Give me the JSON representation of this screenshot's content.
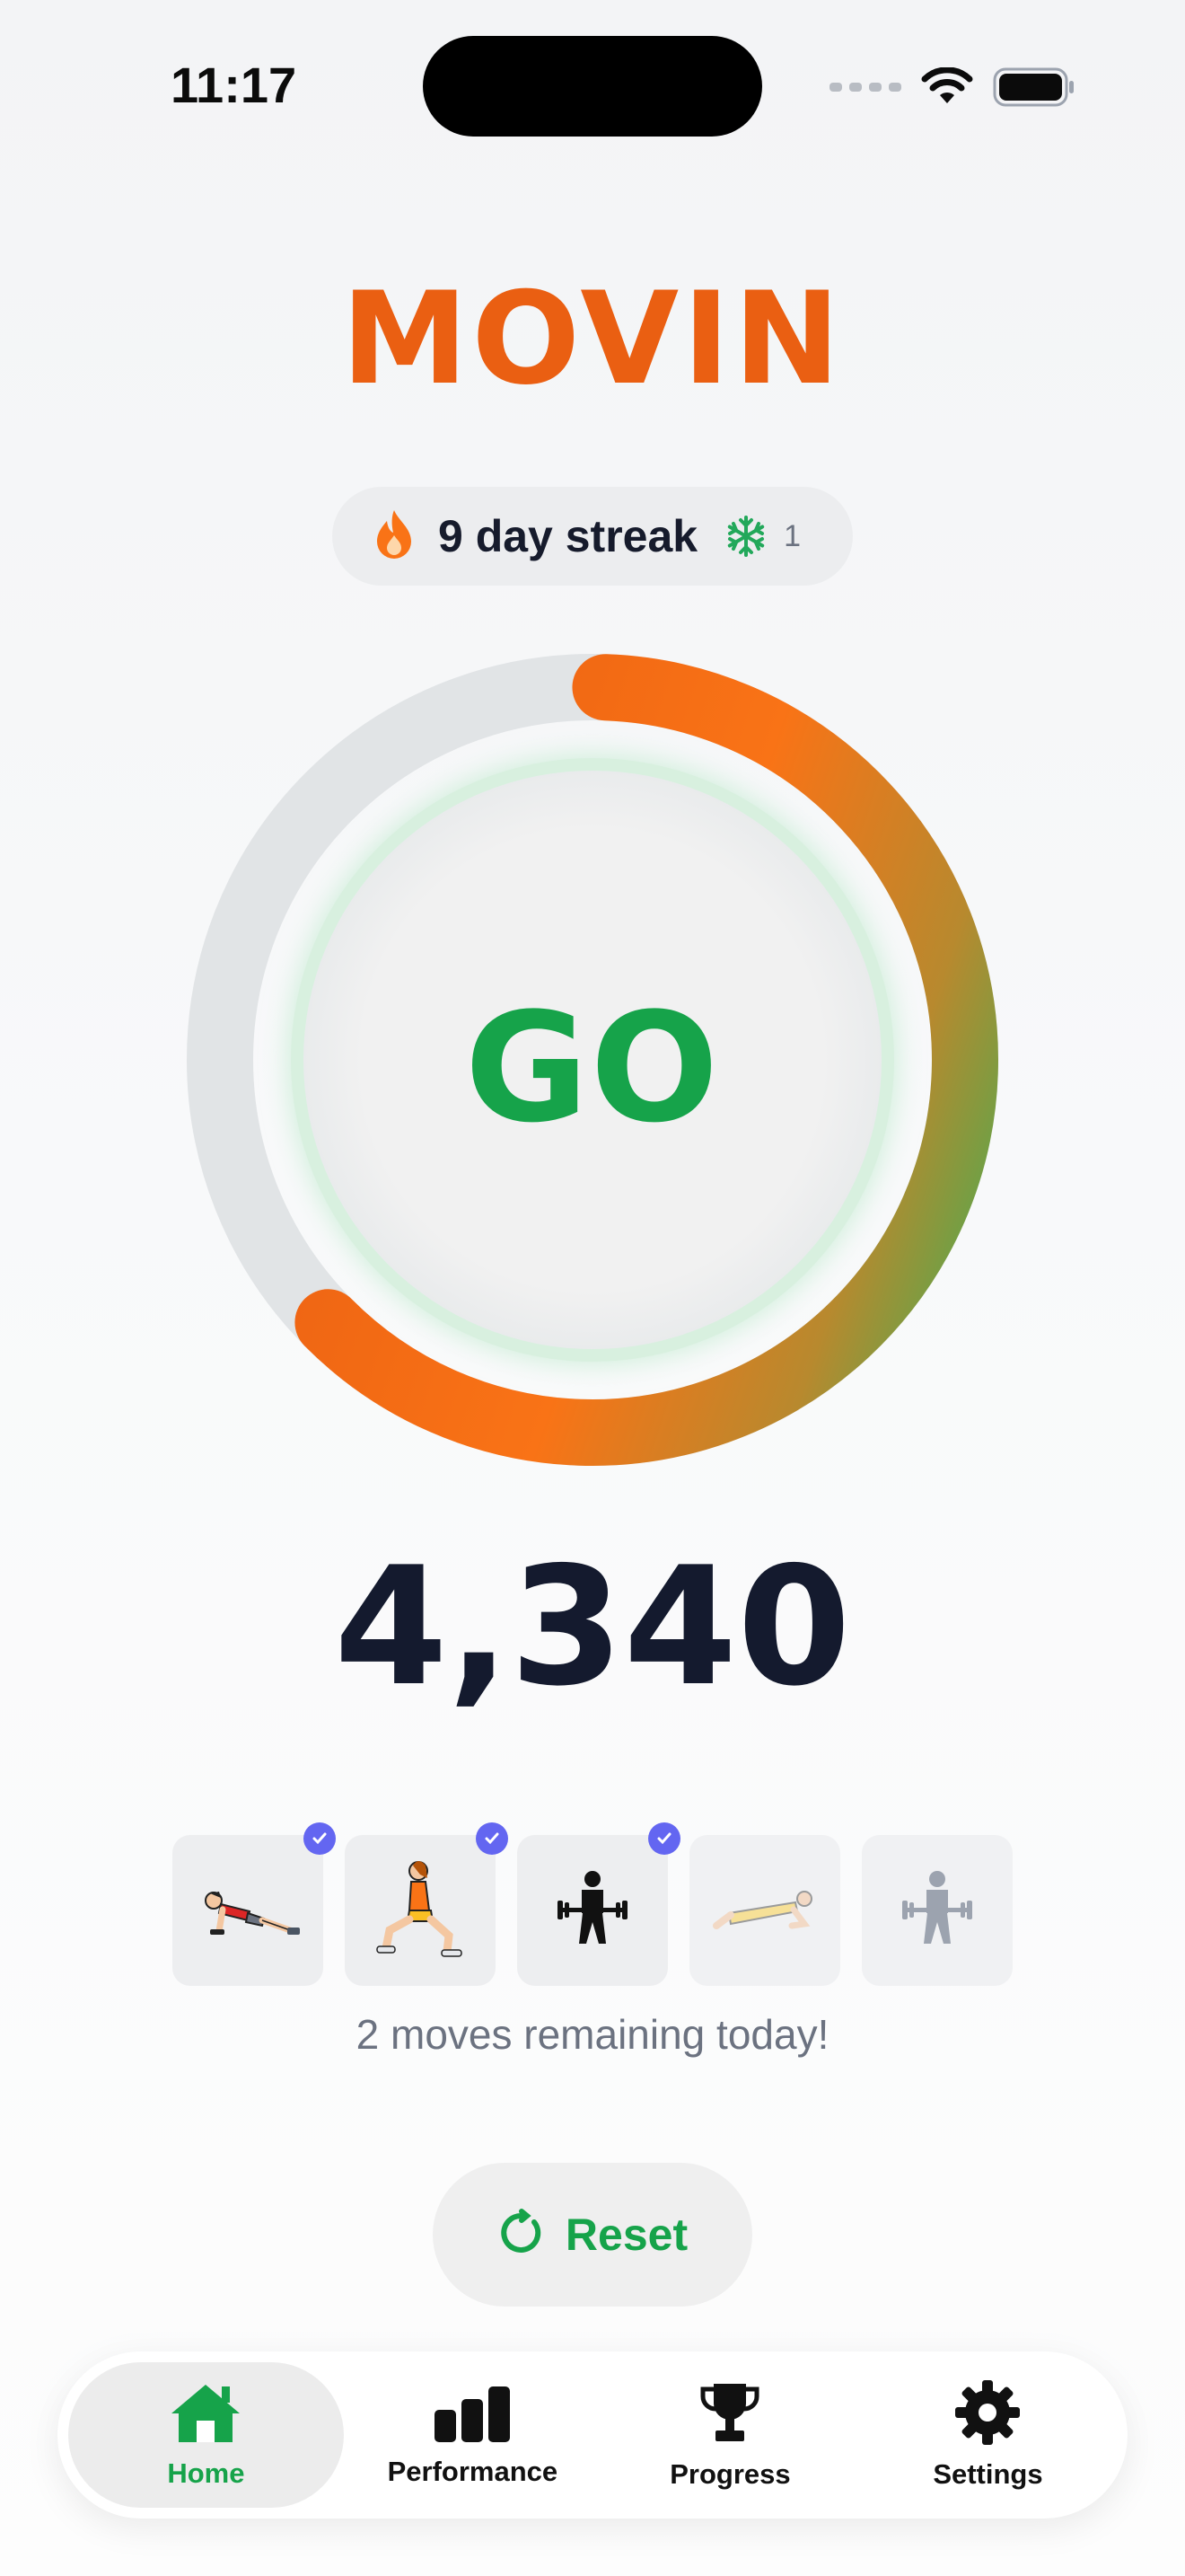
{
  "status": {
    "time": "11:17"
  },
  "app": {
    "title": "MOVIN"
  },
  "streak": {
    "label": "9 day streak",
    "freeze_count": "1"
  },
  "ring": {
    "label": "GO",
    "progress_fraction": 0.62
  },
  "counter": {
    "value": "4,340"
  },
  "exercises": [
    {
      "icon": "pushup-icon",
      "done": true
    },
    {
      "icon": "lunge-icon",
      "done": true
    },
    {
      "icon": "deadlift-icon",
      "done": true
    },
    {
      "icon": "plank-icon",
      "done": false
    },
    {
      "icon": "deadlift-icon",
      "done": false
    }
  ],
  "remaining": {
    "text": "2 moves remaining today!"
  },
  "reset": {
    "label": "Reset"
  },
  "tabs": [
    {
      "label": "Home",
      "icon": "home-icon",
      "active": true
    },
    {
      "label": "Performance",
      "icon": "bar-chart-icon",
      "active": false
    },
    {
      "label": "Progress",
      "icon": "trophy-icon",
      "active": false
    },
    {
      "label": "Settings",
      "icon": "gear-icon",
      "active": false
    }
  ],
  "colors": {
    "accent_orange": "#ea5f12",
    "accent_green": "#16a34a",
    "badge_purple": "#6366f1"
  }
}
